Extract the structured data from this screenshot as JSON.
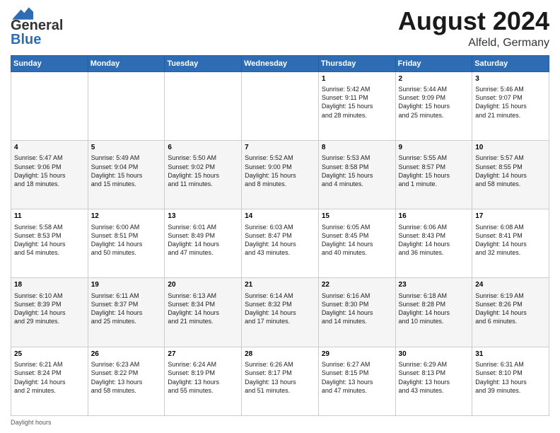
{
  "header": {
    "logo_general": "General",
    "logo_blue": "Blue",
    "month": "August 2024",
    "location": "Alfeld, Germany"
  },
  "weekdays": [
    "Sunday",
    "Monday",
    "Tuesday",
    "Wednesday",
    "Thursday",
    "Friday",
    "Saturday"
  ],
  "weeks": [
    [
      {
        "day": "",
        "info": ""
      },
      {
        "day": "",
        "info": ""
      },
      {
        "day": "",
        "info": ""
      },
      {
        "day": "",
        "info": ""
      },
      {
        "day": "1",
        "info": "Sunrise: 5:42 AM\nSunset: 9:11 PM\nDaylight: 15 hours\nand 28 minutes."
      },
      {
        "day": "2",
        "info": "Sunrise: 5:44 AM\nSunset: 9:09 PM\nDaylight: 15 hours\nand 25 minutes."
      },
      {
        "day": "3",
        "info": "Sunrise: 5:46 AM\nSunset: 9:07 PM\nDaylight: 15 hours\nand 21 minutes."
      }
    ],
    [
      {
        "day": "4",
        "info": "Sunrise: 5:47 AM\nSunset: 9:06 PM\nDaylight: 15 hours\nand 18 minutes."
      },
      {
        "day": "5",
        "info": "Sunrise: 5:49 AM\nSunset: 9:04 PM\nDaylight: 15 hours\nand 15 minutes."
      },
      {
        "day": "6",
        "info": "Sunrise: 5:50 AM\nSunset: 9:02 PM\nDaylight: 15 hours\nand 11 minutes."
      },
      {
        "day": "7",
        "info": "Sunrise: 5:52 AM\nSunset: 9:00 PM\nDaylight: 15 hours\nand 8 minutes."
      },
      {
        "day": "8",
        "info": "Sunrise: 5:53 AM\nSunset: 8:58 PM\nDaylight: 15 hours\nand 4 minutes."
      },
      {
        "day": "9",
        "info": "Sunrise: 5:55 AM\nSunset: 8:57 PM\nDaylight: 15 hours\nand 1 minute."
      },
      {
        "day": "10",
        "info": "Sunrise: 5:57 AM\nSunset: 8:55 PM\nDaylight: 14 hours\nand 58 minutes."
      }
    ],
    [
      {
        "day": "11",
        "info": "Sunrise: 5:58 AM\nSunset: 8:53 PM\nDaylight: 14 hours\nand 54 minutes."
      },
      {
        "day": "12",
        "info": "Sunrise: 6:00 AM\nSunset: 8:51 PM\nDaylight: 14 hours\nand 50 minutes."
      },
      {
        "day": "13",
        "info": "Sunrise: 6:01 AM\nSunset: 8:49 PM\nDaylight: 14 hours\nand 47 minutes."
      },
      {
        "day": "14",
        "info": "Sunrise: 6:03 AM\nSunset: 8:47 PM\nDaylight: 14 hours\nand 43 minutes."
      },
      {
        "day": "15",
        "info": "Sunrise: 6:05 AM\nSunset: 8:45 PM\nDaylight: 14 hours\nand 40 minutes."
      },
      {
        "day": "16",
        "info": "Sunrise: 6:06 AM\nSunset: 8:43 PM\nDaylight: 14 hours\nand 36 minutes."
      },
      {
        "day": "17",
        "info": "Sunrise: 6:08 AM\nSunset: 8:41 PM\nDaylight: 14 hours\nand 32 minutes."
      }
    ],
    [
      {
        "day": "18",
        "info": "Sunrise: 6:10 AM\nSunset: 8:39 PM\nDaylight: 14 hours\nand 29 minutes."
      },
      {
        "day": "19",
        "info": "Sunrise: 6:11 AM\nSunset: 8:37 PM\nDaylight: 14 hours\nand 25 minutes."
      },
      {
        "day": "20",
        "info": "Sunrise: 6:13 AM\nSunset: 8:34 PM\nDaylight: 14 hours\nand 21 minutes."
      },
      {
        "day": "21",
        "info": "Sunrise: 6:14 AM\nSunset: 8:32 PM\nDaylight: 14 hours\nand 17 minutes."
      },
      {
        "day": "22",
        "info": "Sunrise: 6:16 AM\nSunset: 8:30 PM\nDaylight: 14 hours\nand 14 minutes."
      },
      {
        "day": "23",
        "info": "Sunrise: 6:18 AM\nSunset: 8:28 PM\nDaylight: 14 hours\nand 10 minutes."
      },
      {
        "day": "24",
        "info": "Sunrise: 6:19 AM\nSunset: 8:26 PM\nDaylight: 14 hours\nand 6 minutes."
      }
    ],
    [
      {
        "day": "25",
        "info": "Sunrise: 6:21 AM\nSunset: 8:24 PM\nDaylight: 14 hours\nand 2 minutes."
      },
      {
        "day": "26",
        "info": "Sunrise: 6:23 AM\nSunset: 8:22 PM\nDaylight: 13 hours\nand 58 minutes."
      },
      {
        "day": "27",
        "info": "Sunrise: 6:24 AM\nSunset: 8:19 PM\nDaylight: 13 hours\nand 55 minutes."
      },
      {
        "day": "28",
        "info": "Sunrise: 6:26 AM\nSunset: 8:17 PM\nDaylight: 13 hours\nand 51 minutes."
      },
      {
        "day": "29",
        "info": "Sunrise: 6:27 AM\nSunset: 8:15 PM\nDaylight: 13 hours\nand 47 minutes."
      },
      {
        "day": "30",
        "info": "Sunrise: 6:29 AM\nSunset: 8:13 PM\nDaylight: 13 hours\nand 43 minutes."
      },
      {
        "day": "31",
        "info": "Sunrise: 6:31 AM\nSunset: 8:10 PM\nDaylight: 13 hours\nand 39 minutes."
      }
    ]
  ],
  "footer": "Daylight hours"
}
